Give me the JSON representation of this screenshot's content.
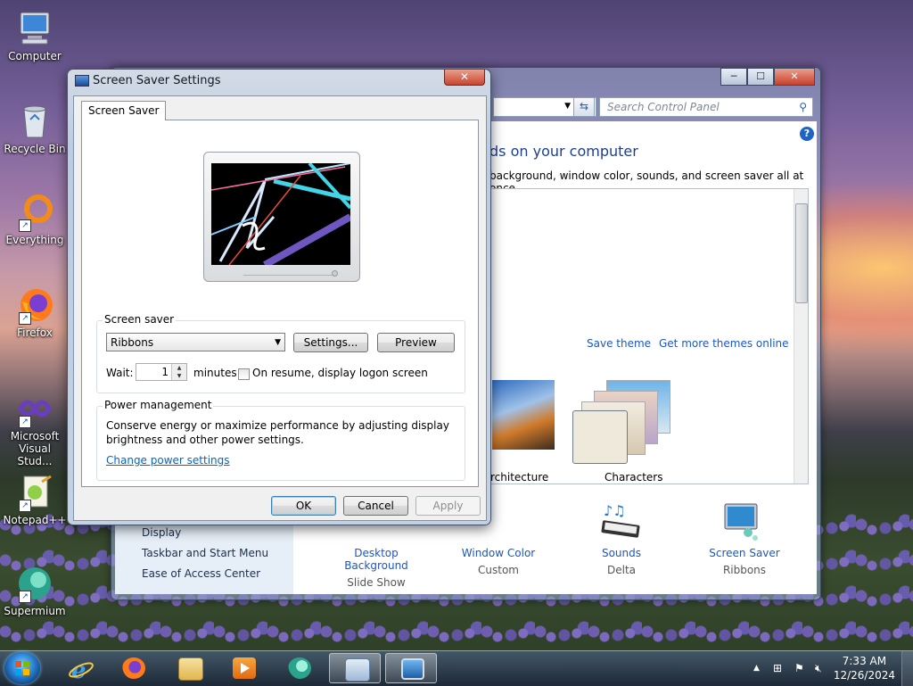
{
  "desktop": {
    "icons": [
      {
        "label": "Computer",
        "icon": "computer-icon"
      },
      {
        "label": "Recycle Bin",
        "icon": "recycle-bin-icon"
      },
      {
        "label": "Everything",
        "icon": "everything-icon"
      },
      {
        "label": "Firefox",
        "icon": "firefox-icon"
      },
      {
        "label": "Microsoft Visual Stud...",
        "icon": "visual-studio-icon"
      },
      {
        "label": "Notepad++",
        "icon": "notepadpp-icon"
      },
      {
        "label": "Supermium",
        "icon": "supermium-icon"
      }
    ]
  },
  "control_panel": {
    "search_placeholder": "Search Control Panel",
    "heading": "ds on your computer",
    "description": "background, window color, sounds, and screen saver all at once.",
    "save_theme": "Save theme",
    "get_more_themes": "Get more themes online",
    "themes": [
      {
        "label": "rchitecture"
      },
      {
        "label": "Characters"
      }
    ],
    "left_links": [
      "Display",
      "Taskbar and Start Menu",
      "Ease of Access Center"
    ],
    "bottom_items": [
      {
        "title": "Desktop Background",
        "sub": "Slide Show"
      },
      {
        "title": "Window Color",
        "sub": "Custom"
      },
      {
        "title": "Sounds",
        "sub": "Delta"
      },
      {
        "title": "Screen Saver",
        "sub": "Ribbons"
      }
    ]
  },
  "dialog": {
    "title": "Screen Saver Settings",
    "tab": "Screen Saver",
    "screen_saver_group": "Screen saver",
    "selected_saver": "Ribbons",
    "settings_button": "Settings...",
    "preview_button": "Preview",
    "wait_label": "Wait:",
    "wait_value": "1",
    "minutes_label": "minutes",
    "resume_label": "On resume, display logon screen",
    "resume_checked": false,
    "power_group": "Power management",
    "power_text_1": "Conserve energy or maximize performance by adjusting display",
    "power_text_2": "brightness and other power settings.",
    "power_link": "Change power settings",
    "ok": "OK",
    "cancel": "Cancel",
    "apply": "Apply"
  },
  "taskbar": {
    "time": "7:33 AM",
    "date": "12/26/2024",
    "pinned": [
      "internet-explorer-icon",
      "firefox-icon",
      "file-explorer-icon",
      "media-player-icon",
      "supermium-icon",
      "control-panel-icon",
      "screen-saver-settings-icon"
    ]
  },
  "colors": {
    "link": "#1c56c4",
    "heading": "#1e3e93",
    "close_button": "#c9452f"
  }
}
